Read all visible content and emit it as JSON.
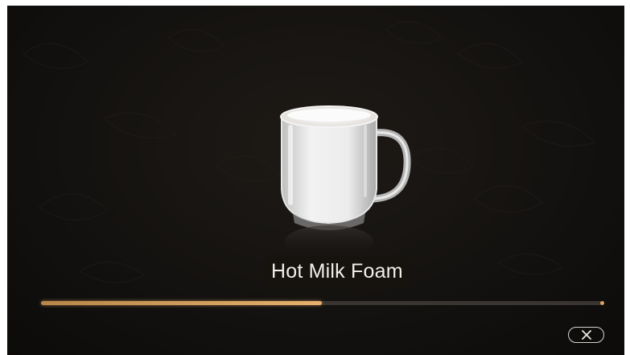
{
  "product": {
    "name": "Hot Milk Foam"
  },
  "progress": {
    "fraction": 0.5
  },
  "icons": {
    "product_image": "milk-foam-mug-icon",
    "cancel": "close-icon"
  },
  "colors": {
    "background": "#141210",
    "progress_fill": "#e7b06c",
    "progress_track": "#3a3530",
    "label_text": "#f1efea"
  }
}
